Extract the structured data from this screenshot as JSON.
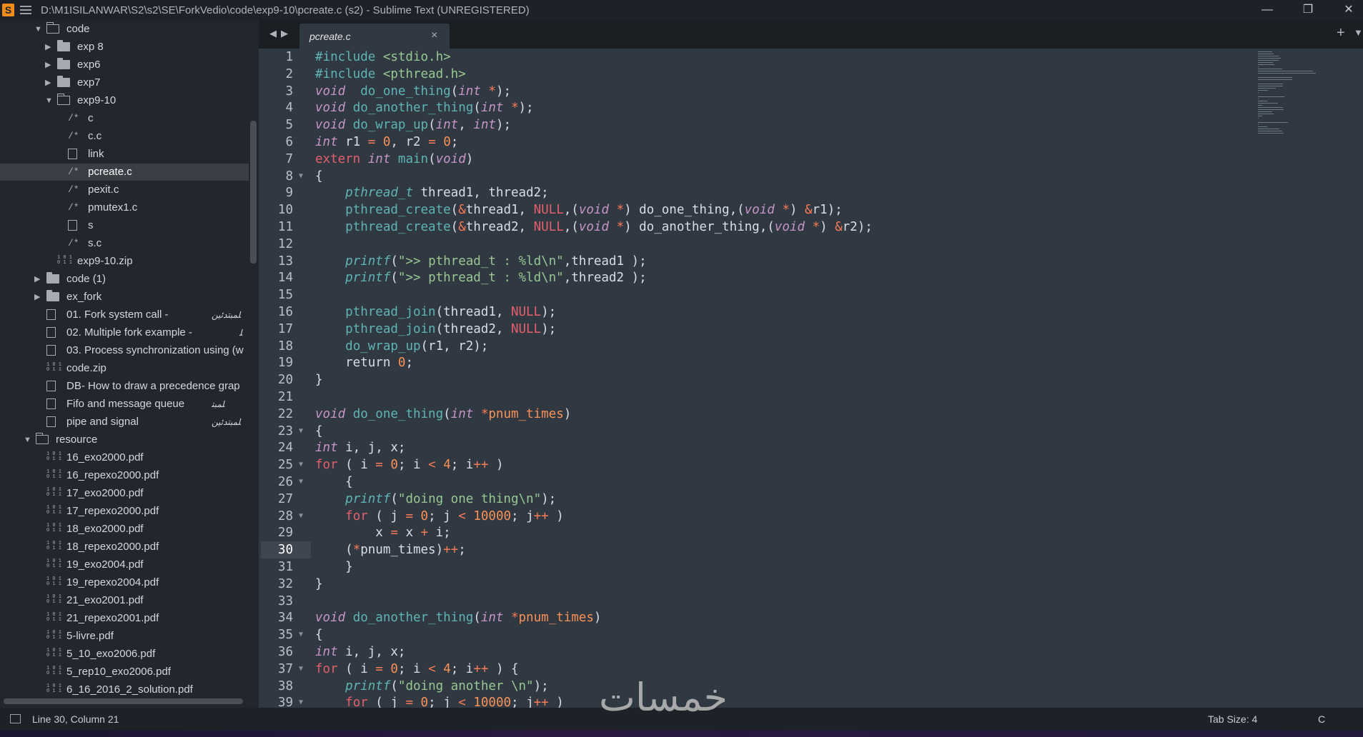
{
  "window": {
    "title": "D:\\M1ISILANWAR\\S2\\s2\\SE\\ForkVedio\\code\\exp9-10\\pcreate.c (s2) - Sublime Text (UNREGISTERED)",
    "logo": "S",
    "minimize": "—",
    "maximize": "❐",
    "close": "✕"
  },
  "sidebar": {
    "items": [
      {
        "label": "code",
        "icon": "folder-open-icon",
        "level": 1,
        "expanded": true
      },
      {
        "label": "exp 8",
        "icon": "folder-icon",
        "level": 2,
        "expanded": false
      },
      {
        "label": "exp6",
        "icon": "folder-icon",
        "level": 2,
        "expanded": false
      },
      {
        "label": "exp7",
        "icon": "folder-icon",
        "level": 2,
        "expanded": false
      },
      {
        "label": "exp9-10",
        "icon": "folder-open-icon",
        "level": 2,
        "expanded": true
      },
      {
        "label": "c",
        "icon": "code-file-icon",
        "level": 3
      },
      {
        "label": "c.c",
        "icon": "code-file-icon",
        "level": 3
      },
      {
        "label": "link",
        "icon": "file-icon",
        "level": 3
      },
      {
        "label": "pcreate.c",
        "icon": "code-file-icon",
        "level": 3,
        "selected": true
      },
      {
        "label": "pexit.c",
        "icon": "code-file-icon",
        "level": 3
      },
      {
        "label": "pmutex1.c",
        "icon": "code-file-icon",
        "level": 3
      },
      {
        "label": "s",
        "icon": "file-icon",
        "level": 3
      },
      {
        "label": "s.c",
        "icon": "code-file-icon",
        "level": 3
      },
      {
        "label": "exp9-10.zip",
        "icon": "binary-file-icon",
        "level": 2
      },
      {
        "label": "code (1)",
        "icon": "folder-icon",
        "level": 1,
        "expanded": false
      },
      {
        "label": "ex_fork",
        "icon": "folder-icon",
        "level": 1,
        "expanded": false
      },
      {
        "label": "01. Fork system call -",
        "icon": "file-icon",
        "level": 1,
        "badge": "ﻠﻤﺒﺘﺪﺋﻴﻦ"
      },
      {
        "label": "02. Multiple fork example -",
        "icon": "file-icon",
        "level": 1,
        "badge": "ﻠ"
      },
      {
        "label": "03. Process synchronization using (w",
        "icon": "file-icon",
        "level": 1
      },
      {
        "label": "code.zip",
        "icon": "binary-file-icon",
        "level": 1
      },
      {
        "label": "DB- How to draw a precedence grap",
        "icon": "file-icon",
        "level": 1
      },
      {
        "label": "Fifo and message queue",
        "icon": "file-icon",
        "level": 1,
        "badge": "ﻠﻤﺒﺘ"
      },
      {
        "label": "pipe and signal",
        "icon": "file-icon",
        "level": 1,
        "badge": "ﻠﻤﺒﺘﺪﺋﻴﻦ"
      },
      {
        "label": "resource",
        "icon": "folder-open-icon",
        "level": 0,
        "expanded": true
      },
      {
        "label": "16_exo2000.pdf",
        "icon": "binary-file-icon",
        "level": 1
      },
      {
        "label": "16_repexo2000.pdf",
        "icon": "binary-file-icon",
        "level": 1
      },
      {
        "label": "17_exo2000.pdf",
        "icon": "binary-file-icon",
        "level": 1
      },
      {
        "label": "17_repexo2000.pdf",
        "icon": "binary-file-icon",
        "level": 1
      },
      {
        "label": "18_exo2000.pdf",
        "icon": "binary-file-icon",
        "level": 1
      },
      {
        "label": "18_repexo2000.pdf",
        "icon": "binary-file-icon",
        "level": 1
      },
      {
        "label": "19_exo2004.pdf",
        "icon": "binary-file-icon",
        "level": 1
      },
      {
        "label": "19_repexo2004.pdf",
        "icon": "binary-file-icon",
        "level": 1
      },
      {
        "label": "21_exo2001.pdf",
        "icon": "binary-file-icon",
        "level": 1
      },
      {
        "label": "21_repexo2001.pdf",
        "icon": "binary-file-icon",
        "level": 1
      },
      {
        "label": "5-livre.pdf",
        "icon": "binary-file-icon",
        "level": 1
      },
      {
        "label": "5_10_exo2006.pdf",
        "icon": "binary-file-icon",
        "level": 1
      },
      {
        "label": "5_rep10_exo2006.pdf",
        "icon": "binary-file-icon",
        "level": 1
      },
      {
        "label": "6_16_2016_2_solution.pdf",
        "icon": "binary-file-icon",
        "level": 1
      }
    ]
  },
  "tabs": {
    "back": "◀",
    "forward": "▶",
    "active_label": "pcreate.c",
    "close": "×",
    "new_tab": "+",
    "menu": "▼"
  },
  "editor": {
    "current_line": 30,
    "lines": [
      {
        "n": 1,
        "segs": [
          [
            "pp",
            "#include "
          ],
          [
            "str",
            "<stdio.h>"
          ]
        ]
      },
      {
        "n": 2,
        "segs": [
          [
            "pp",
            "#include "
          ],
          [
            "str",
            "<pthread.h>"
          ]
        ]
      },
      {
        "n": 3,
        "segs": [
          [
            "ty",
            "void"
          ],
          [
            "",
            "  "
          ],
          [
            "fn",
            "do_one_thing"
          ],
          [
            "",
            "("
          ],
          [
            "ty",
            "int"
          ],
          [
            "op",
            " *"
          ],
          [
            "",
            ");"
          ]
        ]
      },
      {
        "n": 4,
        "segs": [
          [
            "ty",
            "void"
          ],
          [
            "",
            " "
          ],
          [
            "fn",
            "do_another_thing"
          ],
          [
            "",
            "("
          ],
          [
            "ty",
            "int"
          ],
          [
            "op",
            " *"
          ],
          [
            "",
            ");"
          ]
        ]
      },
      {
        "n": 5,
        "segs": [
          [
            "ty",
            "void"
          ],
          [
            "",
            " "
          ],
          [
            "fn",
            "do_wrap_up"
          ],
          [
            "",
            "("
          ],
          [
            "ty",
            "int"
          ],
          [
            "",
            ", "
          ],
          [
            "ty",
            "int"
          ],
          [
            "",
            ");"
          ]
        ]
      },
      {
        "n": 6,
        "segs": [
          [
            "ty",
            "int"
          ],
          [
            "",
            " r1 "
          ],
          [
            "op",
            "="
          ],
          [
            "",
            " "
          ],
          [
            "num",
            "0"
          ],
          [
            "",
            ", r2 "
          ],
          [
            "op",
            "="
          ],
          [
            "",
            " "
          ],
          [
            "num",
            "0"
          ],
          [
            "",
            ";"
          ]
        ]
      },
      {
        "n": 7,
        "segs": [
          [
            "kw",
            "extern"
          ],
          [
            "",
            " "
          ],
          [
            "ty",
            "int"
          ],
          [
            "",
            " "
          ],
          [
            "fn",
            "main"
          ],
          [
            "",
            "("
          ],
          [
            "ty",
            "void"
          ],
          [
            "",
            ")"
          ]
        ]
      },
      {
        "n": 8,
        "fold": true,
        "segs": [
          [
            "",
            "{"
          ]
        ]
      },
      {
        "n": 9,
        "segs": [
          [
            "",
            "    "
          ],
          [
            "it",
            "pthread_t"
          ],
          [
            "",
            " thread1, thread2;"
          ]
        ]
      },
      {
        "n": 10,
        "segs": [
          [
            "",
            "    "
          ],
          [
            "fn",
            "pthread_create"
          ],
          [
            "",
            "("
          ],
          [
            "op",
            "&"
          ],
          [
            "",
            "thread1, "
          ],
          [
            "kw",
            "NULL"
          ],
          [
            "",
            ",("
          ],
          [
            "ty",
            "void"
          ],
          [
            "op",
            " *"
          ],
          [
            "",
            ") do_one_thing,("
          ],
          [
            "ty",
            "void"
          ],
          [
            "op",
            " *"
          ],
          [
            "",
            ") "
          ],
          [
            "op",
            "&"
          ],
          [
            "",
            "r1);"
          ]
        ]
      },
      {
        "n": 11,
        "segs": [
          [
            "",
            "    "
          ],
          [
            "fn",
            "pthread_create"
          ],
          [
            "",
            "("
          ],
          [
            "op",
            "&"
          ],
          [
            "",
            "thread2, "
          ],
          [
            "kw",
            "NULL"
          ],
          [
            "",
            ",("
          ],
          [
            "ty",
            "void"
          ],
          [
            "op",
            " *"
          ],
          [
            "",
            ") do_another_thing,("
          ],
          [
            "ty",
            "void"
          ],
          [
            "op",
            " *"
          ],
          [
            "",
            ") "
          ],
          [
            "op",
            "&"
          ],
          [
            "",
            "r2);"
          ]
        ]
      },
      {
        "n": 12,
        "segs": []
      },
      {
        "n": 13,
        "segs": [
          [
            "",
            "    "
          ],
          [
            "it",
            "printf"
          ],
          [
            "",
            "("
          ],
          [
            "str",
            "\">> pthread_t : %ld\\n\""
          ],
          [
            "",
            ",thread1 );"
          ]
        ]
      },
      {
        "n": 14,
        "segs": [
          [
            "",
            "    "
          ],
          [
            "it",
            "printf"
          ],
          [
            "",
            "("
          ],
          [
            "str",
            "\">> pthread_t : %ld\\n\""
          ],
          [
            "",
            ",thread2 );"
          ]
        ]
      },
      {
        "n": 15,
        "segs": []
      },
      {
        "n": 16,
        "segs": [
          [
            "",
            "    "
          ],
          [
            "fn",
            "pthread_join"
          ],
          [
            "",
            "(thread1, "
          ],
          [
            "kw",
            "NULL"
          ],
          [
            "",
            ");"
          ]
        ]
      },
      {
        "n": 17,
        "segs": [
          [
            "",
            "    "
          ],
          [
            "fn",
            "pthread_join"
          ],
          [
            "",
            "(thread2, "
          ],
          [
            "kw",
            "NULL"
          ],
          [
            "",
            ");"
          ]
        ]
      },
      {
        "n": 18,
        "segs": [
          [
            "",
            "    "
          ],
          [
            "fn",
            "do_wrap_up"
          ],
          [
            "",
            "(r1, r2);"
          ]
        ]
      },
      {
        "n": 19,
        "segs": [
          [
            "",
            "    return "
          ],
          [
            "num",
            "0"
          ],
          [
            "",
            ";"
          ]
        ]
      },
      {
        "n": 20,
        "segs": [
          [
            "",
            "}"
          ]
        ]
      },
      {
        "n": 21,
        "segs": []
      },
      {
        "n": 22,
        "segs": [
          [
            "ty",
            "void"
          ],
          [
            "",
            " "
          ],
          [
            "fn",
            "do_one_thing"
          ],
          [
            "",
            "("
          ],
          [
            "ty",
            "int"
          ],
          [
            "op",
            " *"
          ],
          [
            "num",
            "pnum_times"
          ],
          [
            "",
            ")"
          ]
        ]
      },
      {
        "n": 23,
        "fold": true,
        "segs": [
          [
            "",
            "{"
          ]
        ]
      },
      {
        "n": 24,
        "segs": [
          [
            "ty",
            "int"
          ],
          [
            "",
            " i, j, x;"
          ]
        ]
      },
      {
        "n": 25,
        "fold": true,
        "segs": [
          [
            "kw",
            "for"
          ],
          [
            "",
            " ( i "
          ],
          [
            "op",
            "="
          ],
          [
            "",
            " "
          ],
          [
            "num",
            "0"
          ],
          [
            "",
            "; i "
          ],
          [
            "op",
            "<"
          ],
          [
            "",
            " "
          ],
          [
            "num",
            "4"
          ],
          [
            "",
            "; i"
          ],
          [
            "op",
            "++"
          ],
          [
            "",
            " )"
          ]
        ]
      },
      {
        "n": 26,
        "fold": true,
        "segs": [
          [
            "",
            "    {"
          ]
        ]
      },
      {
        "n": 27,
        "segs": [
          [
            "",
            "    "
          ],
          [
            "it",
            "printf"
          ],
          [
            "",
            "("
          ],
          [
            "str",
            "\"doing one thing\\n\""
          ],
          [
            "",
            ");"
          ]
        ]
      },
      {
        "n": 28,
        "fold": true,
        "segs": [
          [
            "",
            "    "
          ],
          [
            "kw",
            "for"
          ],
          [
            "",
            " ( j "
          ],
          [
            "op",
            "="
          ],
          [
            "",
            " "
          ],
          [
            "num",
            "0"
          ],
          [
            "",
            "; j "
          ],
          [
            "op",
            "<"
          ],
          [
            "",
            " "
          ],
          [
            "num",
            "10000"
          ],
          [
            "",
            "; j"
          ],
          [
            "op",
            "++"
          ],
          [
            "",
            " )"
          ]
        ]
      },
      {
        "n": 29,
        "segs": [
          [
            "",
            "        x "
          ],
          [
            "op",
            "="
          ],
          [
            "",
            " x "
          ],
          [
            "op",
            "+"
          ],
          [
            "",
            " i;"
          ]
        ]
      },
      {
        "n": 30,
        "segs": [
          [
            "",
            "    ("
          ],
          [
            "op",
            "*"
          ],
          [
            "",
            "pnum_times)"
          ],
          [
            "op",
            "++"
          ],
          [
            "",
            ";"
          ]
        ]
      },
      {
        "n": 31,
        "segs": [
          [
            "",
            "    }"
          ]
        ]
      },
      {
        "n": 32,
        "segs": [
          [
            "",
            "}"
          ]
        ]
      },
      {
        "n": 33,
        "segs": []
      },
      {
        "n": 34,
        "segs": [
          [
            "ty",
            "void"
          ],
          [
            "",
            " "
          ],
          [
            "fn",
            "do_another_thing"
          ],
          [
            "",
            "("
          ],
          [
            "ty",
            "int"
          ],
          [
            "op",
            " *"
          ],
          [
            "num",
            "pnum_times"
          ],
          [
            "",
            ")"
          ]
        ]
      },
      {
        "n": 35,
        "fold": true,
        "segs": [
          [
            "",
            "{"
          ]
        ]
      },
      {
        "n": 36,
        "segs": [
          [
            "ty",
            "int"
          ],
          [
            "",
            " i, j, x;"
          ]
        ]
      },
      {
        "n": 37,
        "fold": true,
        "segs": [
          [
            "kw",
            "for"
          ],
          [
            "",
            " ( i "
          ],
          [
            "op",
            "="
          ],
          [
            "",
            " "
          ],
          [
            "num",
            "0"
          ],
          [
            "",
            "; i "
          ],
          [
            "op",
            "<"
          ],
          [
            "",
            " "
          ],
          [
            "num",
            "4"
          ],
          [
            "",
            "; i"
          ],
          [
            "op",
            "++"
          ],
          [
            "",
            " ) {"
          ]
        ]
      },
      {
        "n": 38,
        "segs": [
          [
            "",
            "    "
          ],
          [
            "it",
            "printf"
          ],
          [
            "",
            "("
          ],
          [
            "str",
            "\"doing another \\n\""
          ],
          [
            "",
            ");"
          ]
        ]
      },
      {
        "n": 39,
        "fold": true,
        "segs": [
          [
            "",
            "    "
          ],
          [
            "kw",
            "for"
          ],
          [
            "",
            " ( j "
          ],
          [
            "op",
            "="
          ],
          [
            "",
            " "
          ],
          [
            "num",
            "0"
          ],
          [
            "",
            "; j "
          ],
          [
            "op",
            "<"
          ],
          [
            "",
            " "
          ],
          [
            "num",
            "10000"
          ],
          [
            "",
            "; j"
          ],
          [
            "op",
            "++"
          ],
          [
            "",
            " )"
          ]
        ]
      }
    ]
  },
  "status": {
    "position": "Line 30, Column 21",
    "tab_size": "Tab Size: 4",
    "syntax": "C"
  },
  "watermark": "خمسات"
}
